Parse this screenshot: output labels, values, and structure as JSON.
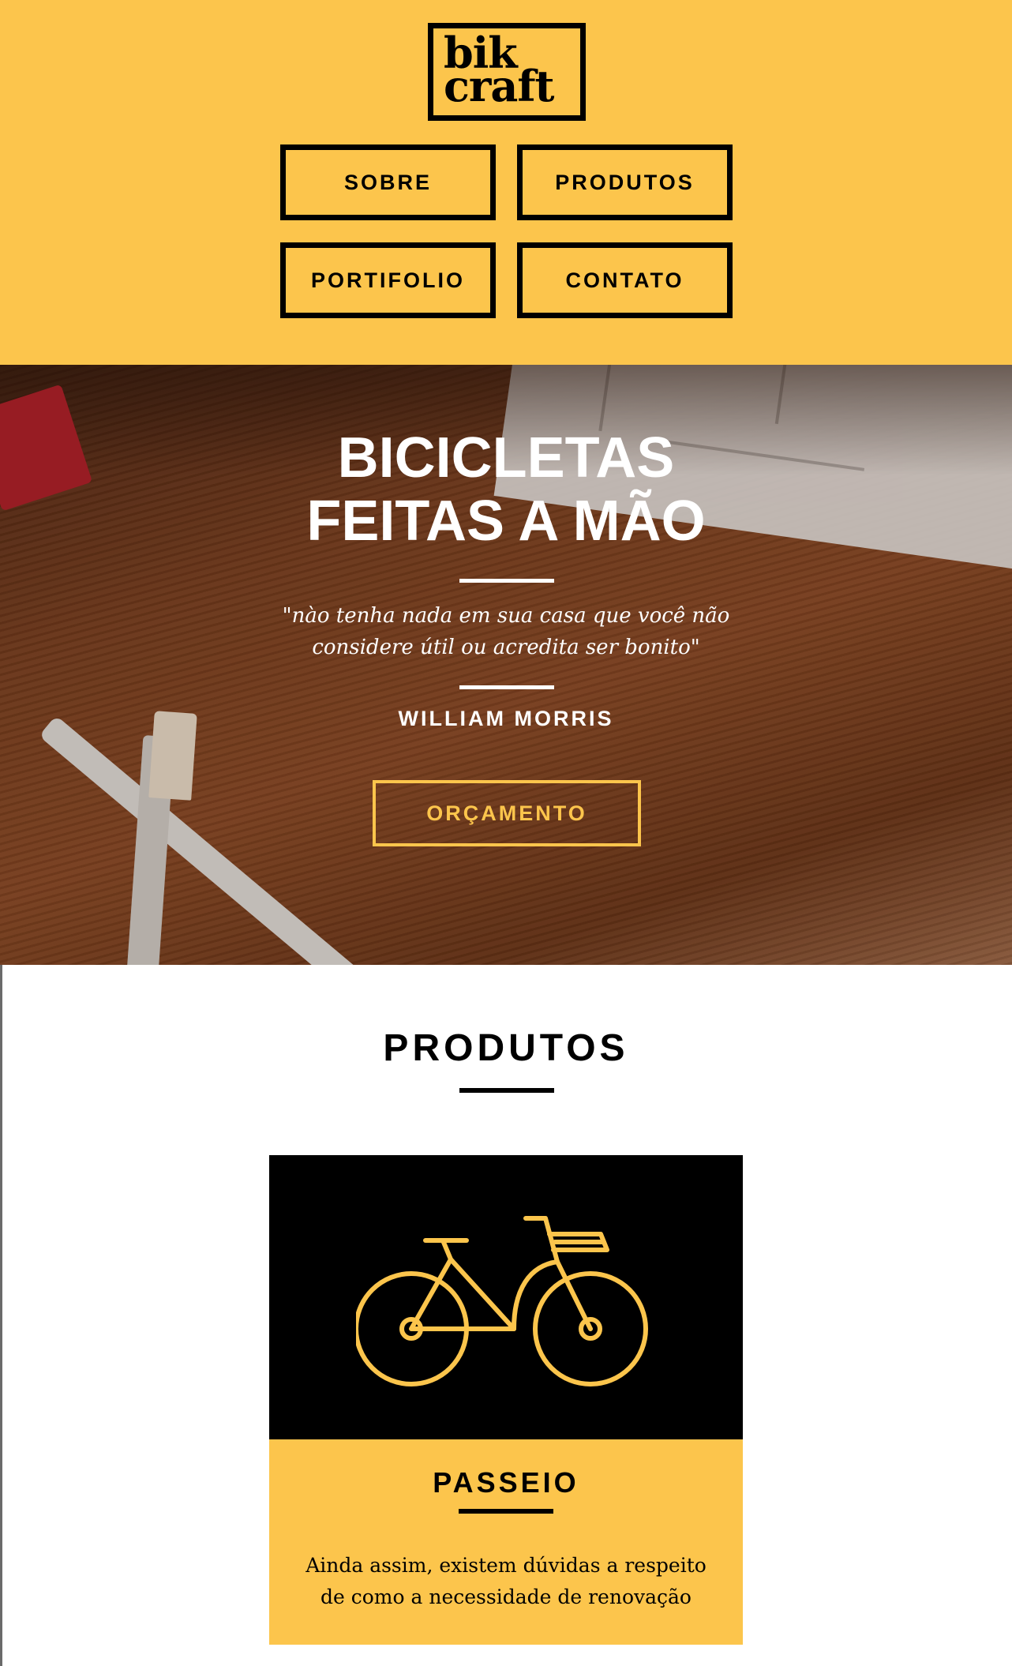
{
  "logo": {
    "line1": "bik",
    "line2": "craft"
  },
  "nav": {
    "sobre": "SOBRE",
    "produtos": "PRODUTOS",
    "portfolio": "PORTIFOLIO",
    "contato": "CONTATO"
  },
  "hero": {
    "title_line1": "BICICLETAS",
    "title_line2": "FEITAS A MÃO",
    "quote_line1": "\"nào tenha nada em sua casa que você não",
    "quote_line2": "considere útil ou acredita ser bonito\"",
    "author": "WILLIAM MORRIS",
    "cta": "ORÇAMENTO"
  },
  "products": {
    "title": "PRODUTOS",
    "cards": [
      {
        "icon": "bicycle-icon",
        "title": "PASSEIO",
        "text_line1": "Ainda assim, existem dúvidas a respeito",
        "text_line2": "de como a necessidade de renovação"
      }
    ]
  },
  "colors": {
    "brand_yellow": "#fcc54c",
    "black": "#000000",
    "white": "#ffffff"
  }
}
